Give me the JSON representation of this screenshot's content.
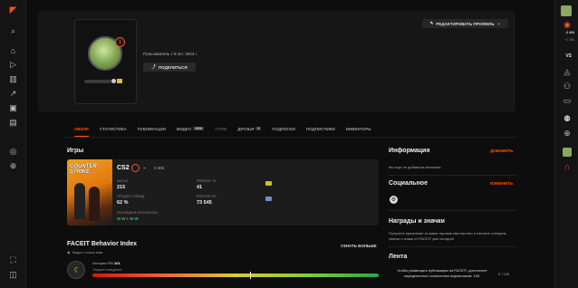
{
  "profile": {
    "member_since": "Пользователь с 8 окт. 2024 г.",
    "share_label": "ПОДЕЛИТЬСЯ",
    "edit_label": "РЕДАКТИРОВАТЬ ПРОФИЛЬ",
    "level": "1"
  },
  "tabs": [
    {
      "label": "ОБЗОР"
    },
    {
      "label": "СТАТИСТИКА"
    },
    {
      "label": "ПУБЛИКАЦИИ"
    },
    {
      "label": "ВИДЕО",
      "badge": "NEW"
    },
    {
      "label": "СТИМ"
    },
    {
      "label": "ДРУЗЬЯ",
      "badge": "3"
    },
    {
      "label": "ПОДПИСКИ"
    },
    {
      "label": "ПОДПИСЧИКИ"
    },
    {
      "label": "ИНВЕНТАРЬ"
    }
  ],
  "games": {
    "title": "Игры",
    "cover_text": "COUNTER STRIKE",
    "name": "CS2",
    "elo": "2 404",
    "matches_label": "МАТЧИ",
    "matches_value": "215",
    "winrate_label": "ПРОЦЕНТ ПОБЕД",
    "winrate_value": "62 %",
    "rating_label": "РЕЙТИНГ 75",
    "rating_value": "41",
    "rating2_label": "РЕЙТИНГ ВЗ",
    "rating2_value": "73 545",
    "recent_label": "ПОСЛЕДНИЕ РЕЗУЛЬТАТЫ",
    "recent": [
      "W",
      "W",
      "L",
      "W",
      "W"
    ]
  },
  "behavior": {
    "title": "FACEIT Behavior Index",
    "visibility": "Видно только вам",
    "learn_more": "УЗНАТЬ БОЛЬШЕ",
    "history_label": "История FBI",
    "history_value": "101",
    "current_label": "Текущее поведение:",
    "level_fraction": 0.55
  },
  "info": {
    "title": "Информация",
    "add": "ДОБАВИТЬ",
    "text": "Вы еще не добавили описание"
  },
  "social": {
    "title": "Социальное",
    "edit": "ИЗМЕНИТЬ"
  },
  "awards": {
    "title": "Награды и значки",
    "text": "Получите признание за ваше игровое мастерство и начните собирать значки и знаки от FACEIT уже сегодня!"
  },
  "feed": {
    "title": "Лента",
    "text": "Чтобы размещать публикации на FACEIT, достигните определенного количества подписчиков: 100.",
    "count": "0 / 100"
  },
  "right_sidebar": {
    "points": "-2 404",
    "points2": "+1 250",
    "vs": "VS"
  },
  "colors": {
    "accent": "#ff5500"
  }
}
